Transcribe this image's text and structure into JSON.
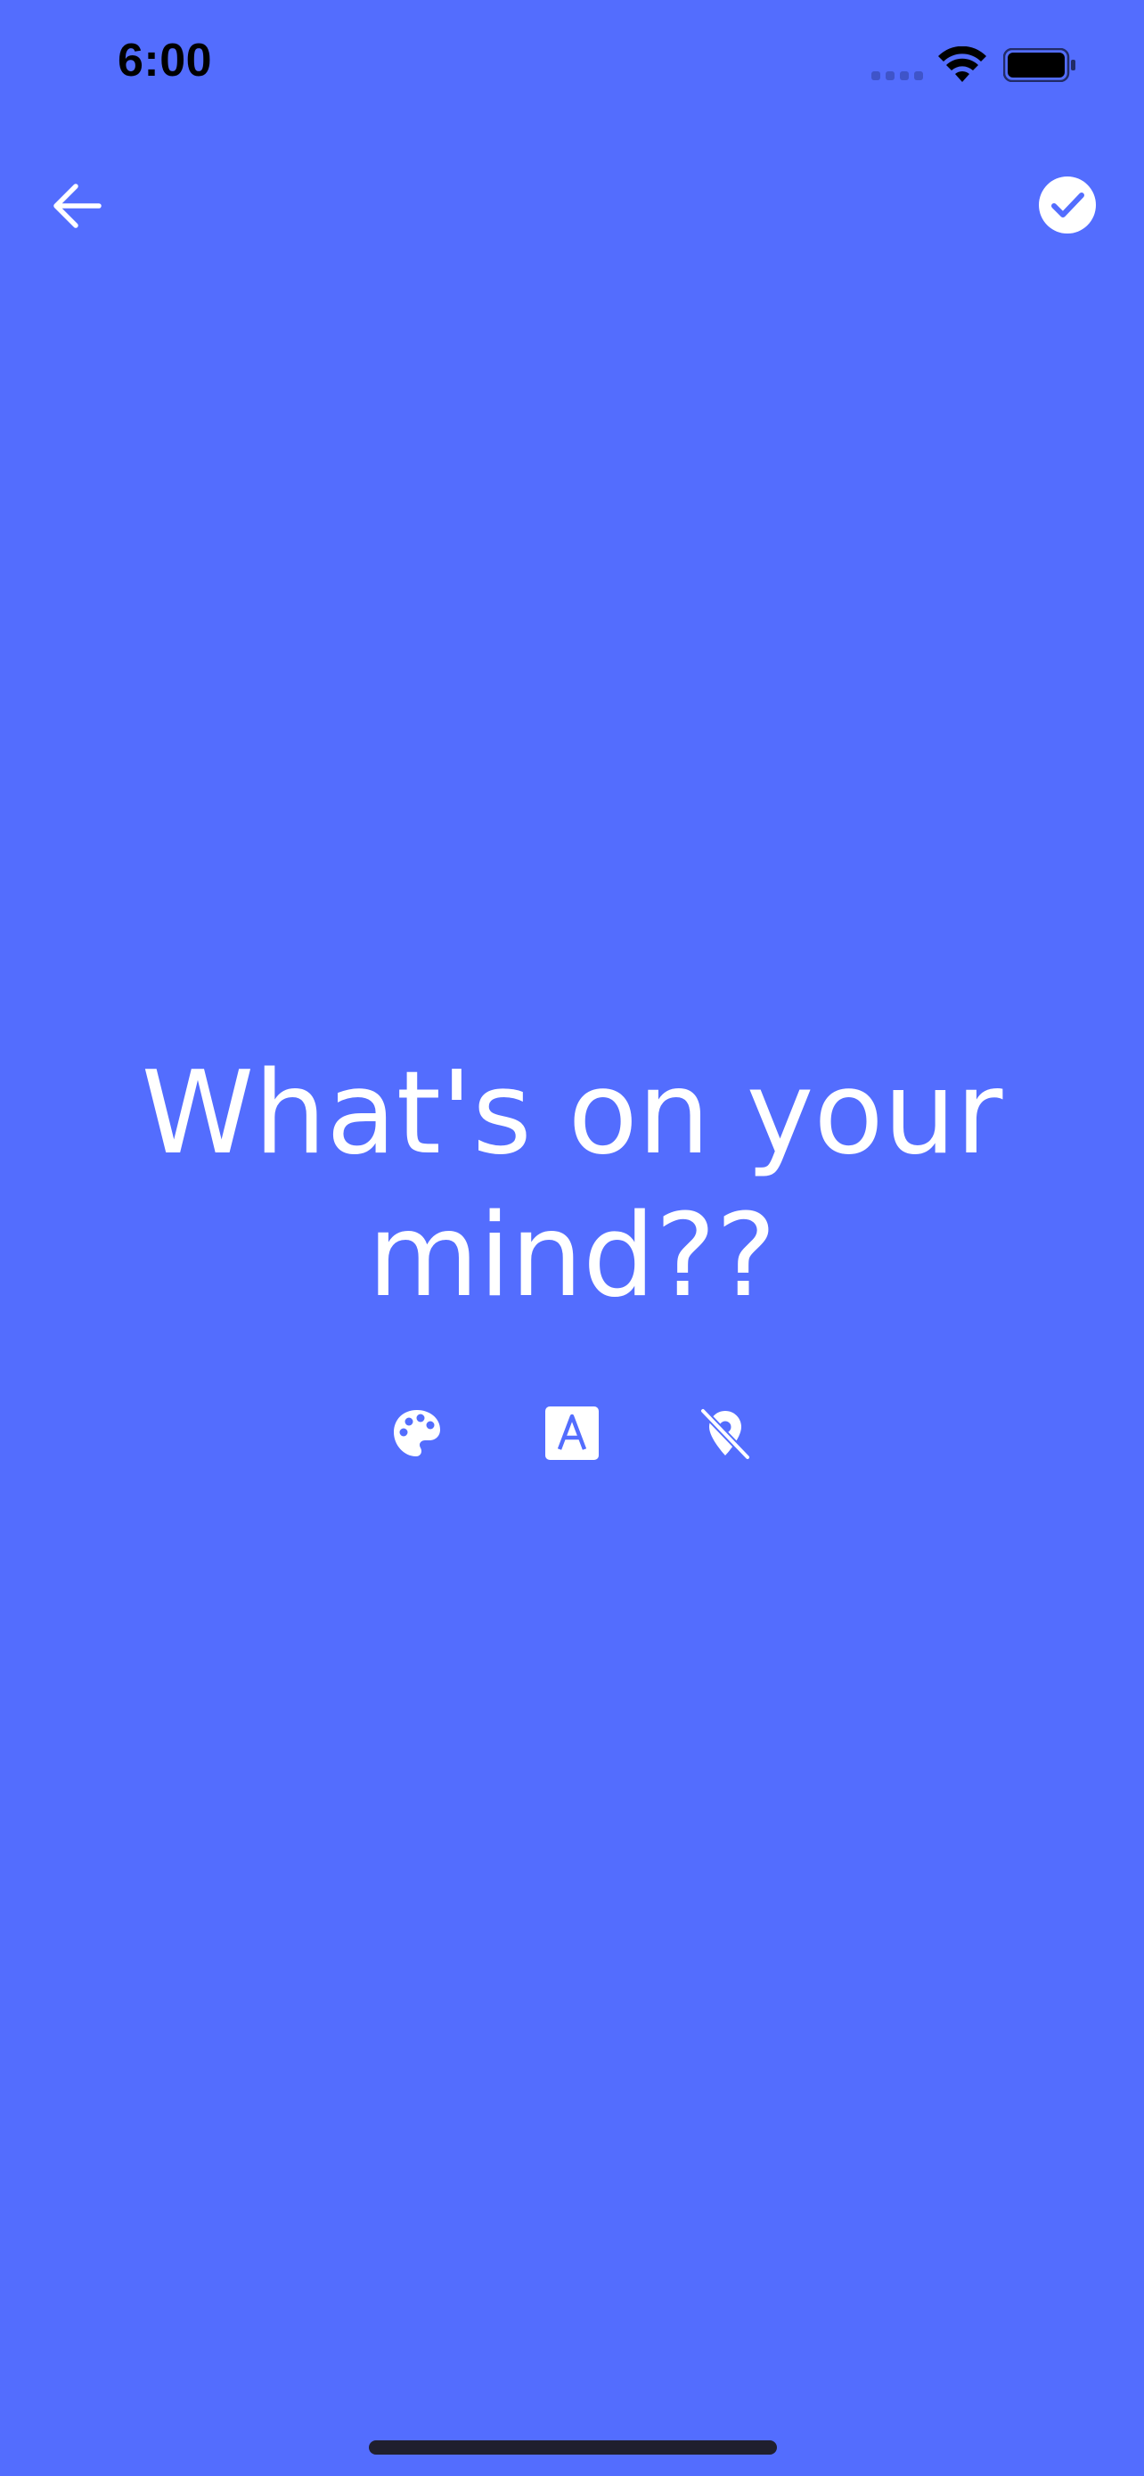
{
  "status_bar": {
    "time": "6:00",
    "signal_icon": "cellular-signal-icon",
    "wifi_icon": "wifi-icon",
    "battery_icon": "battery-icon"
  },
  "app_bar": {
    "back_icon": "arrow-left-icon",
    "done_icon": "check-circle-icon"
  },
  "editor": {
    "text": "What's on your mind??"
  },
  "toolbar": {
    "items": [
      {
        "name": "color-palette",
        "icon": "palette-icon"
      },
      {
        "name": "font-style",
        "icon": "font-icon"
      },
      {
        "name": "location-off",
        "icon": "location-off-icon"
      }
    ]
  },
  "colors": {
    "background": "#536DFE",
    "foreground": "#FFFFFF",
    "status_text": "#000000"
  }
}
